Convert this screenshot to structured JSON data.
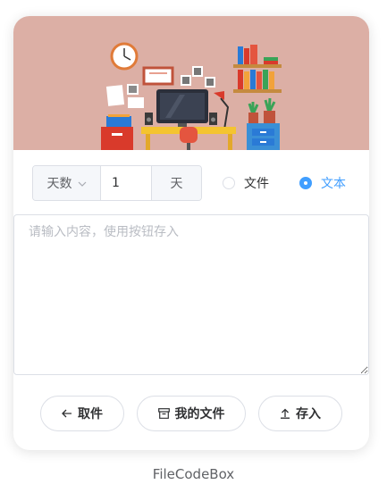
{
  "expire": {
    "unit_label": "天数",
    "value": "1",
    "suffix": "天"
  },
  "type_radio": {
    "file_label": "文件",
    "text_label": "文本",
    "selected": "text"
  },
  "textarea": {
    "placeholder": "请输入内容，使用按钮存入"
  },
  "buttons": {
    "get_label": "取件",
    "myfiles_label": "我的文件",
    "save_label": "存入"
  },
  "footer": {
    "brand": "FileCodeBox"
  },
  "colors": {
    "accent": "#409eff",
    "banner_bg": "#dcafa5"
  },
  "icons": {
    "get": "arrow-left-icon",
    "myfiles": "box-icon",
    "save": "upload-icon",
    "unit_dropdown": "chevron-down-icon"
  }
}
